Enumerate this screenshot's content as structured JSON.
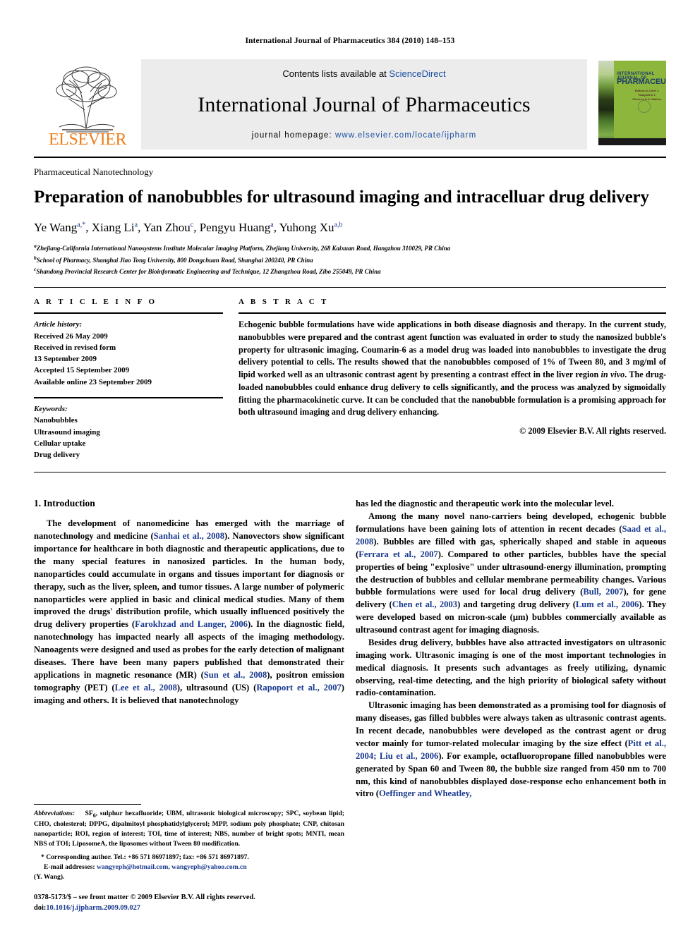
{
  "running_head": "International Journal of Pharmaceutics 384 (2010) 148–153",
  "masthead": {
    "contents_prefix": "Contents lists available at ",
    "sciencedirect": "ScienceDirect",
    "journal_name": "International Journal of Pharmaceutics",
    "homepage_prefix": "journal homepage: ",
    "homepage_url": "www.elsevier.com/locate/ijpharm",
    "publisher_logo_text": "ELSEVIER",
    "cover": {
      "line1": "INTERNATIONAL JOURNAL OF",
      "line2": "PHARMACEUTICS",
      "sub": "Editors-in-Chief\nJ. Hadgraft  A.T. Florence\nK.A. Walters"
    }
  },
  "article": {
    "section_label": "Pharmaceutical Nanotechnology",
    "title": "Preparation of nanobubbles for ultrasound imaging and intracelluar drug delivery",
    "authors_html": "Ye Wang<sup>a,<span class=\"star\">*</span></sup>, Xiang Li<sup>a</sup>, Yan Zhou<sup>c</sup>, Pengyu Huang<sup>a</sup>, Yuhong Xu<sup>a,b</sup>",
    "affiliations": [
      {
        "marker": "a",
        "text": "Zhejiang-California International Nanosystems Institute Molecular Imaging Platform, Zhejiang University, 268 Kaixuan Road, Hangzhou 310029, PR China"
      },
      {
        "marker": "b",
        "text": "School of Pharmacy, Shanghai Jiao Tong University, 800 Dongchuan Road, Shanghai 200240, PR China"
      },
      {
        "marker": "c",
        "text": "Shandong Provincial Research Center for Bioinformatic Engineering and Technique, 12 Zhangzhou Road, Zibo 255049, PR China"
      }
    ]
  },
  "article_info": {
    "heading": "A R T I C L E    I N F O",
    "history_label": "Article history:",
    "history_lines": [
      "Received 26 May 2009",
      "Received in revised form",
      "13 September 2009",
      "Accepted 15 September 2009",
      "Available online 23 September 2009"
    ],
    "keywords_label": "Keywords:",
    "keywords": [
      "Nanobubbles",
      "Ultrasound imaging",
      "Cellular uptake",
      "Drug delivery"
    ]
  },
  "abstract": {
    "heading": "A B S T R A C T",
    "text_html": "Echogenic bubble formulations have wide applications in both disease diagnosis and therapy. In the current study, nanobubbles were prepared and the contrast agent function was evaluated in order to study the nanosized bubble's property for ultrasonic imaging. Coumarin-6 as a model drug was loaded into nanobubbles to investigate the drug delivery potential to cells. The results showed that the nanobubbles composed of 1% of Tween 80, and 3 mg/ml of lipid worked well as an ultrasonic contrast agent by presenting a contrast effect in the liver region <em>in vivo</em>. The drug-loaded nanobubbles could enhance drug delivery to cells significantly, and the process was analyzed by sigmoidally fitting the pharmacokinetic curve. It can be concluded that the nanobubble formulation is a promising approach for both ultrasound imaging and drug delivery enhancing.",
    "copyright": "© 2009 Elsevier B.V. All rights reserved."
  },
  "body": {
    "intro_heading": "1. Introduction",
    "left_paragraphs_html": [
      "The development of nanomedicine has emerged with the marriage of nanotechnology and medicine (<span class=\"ref\">Sanhai et al., 2008</span>). Nanovectors show significant importance for healthcare in both diagnostic and therapeutic applications, due to the many special features in nanosized particles. In the human body, nanoparticles could accumulate in organs and tissues important for diagnosis or therapy, such as the liver, spleen, and tumor tissues. A large number of polymeric nanoparticles were applied in basic and clinical medical studies. Many of them improved the drugs' distribution profile, which usually influenced positively the drug delivery properties (<span class=\"ref\">Farokhzad and Langer, 2006</span>). In the diagnostic field, nanotechnology has impacted nearly all aspects of the imaging methodology. Nanoagents were designed and used as probes for the early detection of malignant diseases. There have been many papers published that demonstrated their applications in magnetic resonance (MR) (<span class=\"ref\">Sun et al., 2008</span>), positron emission tomography (PET) (<span class=\"ref\">Lee et al., 2008</span>), ultrasound (US) (<span class=\"ref\">Rapoport et al., 2007</span>) imaging and others. It is believed that nanotechnology"
    ],
    "right_paragraphs_html": [
      "has led the diagnostic and therapeutic work into the molecular level.",
      "Among the many novel nano-carriers being developed, echogenic bubble formulations have been gaining lots of attention in recent decades (<span class=\"ref\">Saad et al., 2008</span>). Bubbles are filled with gas, spherically shaped and stable in aqueous (<span class=\"ref\">Ferrara et al., 2007</span>). Compared to other particles, bubbles have the special properties of being \"explosive\" under ultrasound-energy illumination, prompting the destruction of bubbles and cellular membrane permeability changes. Various bubble formulations were used for local drug delivery (<span class=\"ref\">Bull, 2007</span>), for gene delivery (<span class=\"ref\">Chen et al., 2003</span>) and targeting drug delivery (<span class=\"ref\">Lum et al., 2006</span>). They were developed based on micron-scale (μm) bubbles commercially available as ultrasound contrast agent for imaging diagnosis.",
      "Besides drug delivery, bubbles have also attracted investigators on ultrasonic imaging work. Ultrasonic imaging is one of the most important technologies in medical diagnosis. It presents such advantages as freely utilizing, dynamic observing, real-time detecting, and the high priority of biological safety without radio-contamination.",
      "Ultrasonic imaging has been demonstrated as a promising tool for diagnosis of many diseases, gas filled bubbles were always taken as ultrasonic contrast agents. In recent decade, nanobubbles were developed as the contrast agent or drug vector mainly for tumor-related molecular imaging by the size effect (<span class=\"ref\">Pitt et al., 2004; Liu et al., 2006</span>). For example, octafluoropropane filled nanobubbles were generated by Span 60 and Tween 80, the bubble size ranged from 450 nm to 700 nm, this kind of nanobubbles displayed dose-response echo enhancement both in vitro (<span class=\"ref\">Oeffinger and Wheatley,</span>"
    ]
  },
  "footnotes": {
    "abbreviations_html": "<span class=\"it\">Abbreviations:</span>&nbsp;&nbsp;&nbsp;&nbsp;SF<sub>6</sub>, sulphur hexafluoride; UBM, ultrasonic biological microscopy; SPC, soybean lipid; CHO, cholesterol; DPPG, dipalmitoyl phosphatidylglycerol; MPP, sodium poly phosphate; CNP, chitosan nanoparticle; ROI, region of interest; TOI, time of interest; NBS, number of bright spots; MNTI, mean NBS of TOI; LiposomeA, the liposomes without Tween 80 modification.",
    "corresponding_html": "* Corresponding author. Tel.: +86 571 86971897; fax: +86 571 86971897.",
    "email_label": "E-mail addresses:",
    "emails": "wangyeph@hotmail.com, wangyeph@yahoo.com.cn",
    "email_owner": "(Y. Wang).",
    "issn_line": "0378-5173/$ – see front matter © 2009 Elsevier B.V. All rights reserved.",
    "doi_label": "doi:",
    "doi_value": "10.1016/j.ijpharm.2009.09.027"
  }
}
